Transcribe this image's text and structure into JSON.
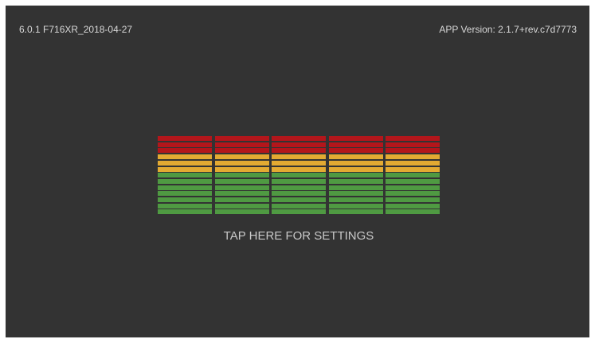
{
  "header": {
    "firmware_label": "6.0.1 F716XR_2018-04-27",
    "app_version_label": "APP Version: 2.1.7+rev.c7d7773"
  },
  "level_meter": {
    "columns": 5,
    "segments_per_column": 13,
    "levels": [
      1,
      1,
      1,
      1,
      1
    ],
    "zones": [
      {
        "name": "red",
        "segments": 3,
        "color": "#b3161b"
      },
      {
        "name": "yellow",
        "segments": 3,
        "color": "#e3aa32"
      },
      {
        "name": "green",
        "segments": 7,
        "color": "#4f9a42"
      }
    ]
  },
  "settings_link": {
    "label": "TAP HERE FOR SETTINGS"
  },
  "colors": {
    "background": "#333333",
    "text": "#d8d8d8"
  }
}
